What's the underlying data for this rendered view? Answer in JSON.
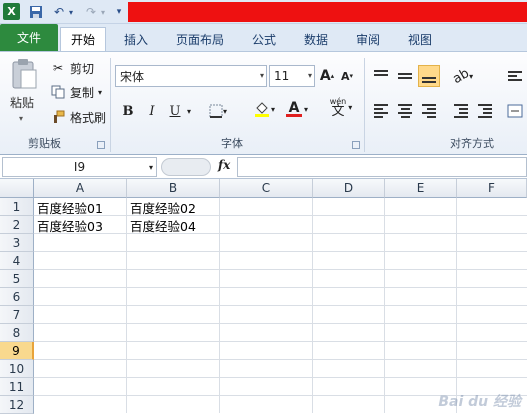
{
  "tabs": [
    "文件",
    "开始",
    "插入",
    "页面布局",
    "公式",
    "数据",
    "审阅",
    "视图"
  ],
  "clipboard": {
    "paste": "粘贴",
    "cut": "剪切",
    "copy": "复制",
    "format_painter": "格式刷",
    "group_label": "剪贴板"
  },
  "font": {
    "name": "宋体",
    "size": "11",
    "bold": "B",
    "italic": "I",
    "underline": "U",
    "group_label": "字体",
    "grow": "A",
    "shrink": "A",
    "color_letter": "A",
    "phonetic_top": "wén",
    "phonetic_char": "文",
    "font_color": "#e02020",
    "fill_color": "#ffff00"
  },
  "alignment": {
    "group_label": "对齐方式"
  },
  "formula_bar": {
    "cell_ref": "I9",
    "fx": "fx",
    "formula": ""
  },
  "columns": [
    "A",
    "B",
    "C",
    "D",
    "E",
    "F"
  ],
  "rows": [
    "1",
    "2",
    "3",
    "4",
    "5",
    "6",
    "7",
    "8",
    "9",
    "10",
    "11",
    "12"
  ],
  "active_row": "9",
  "cells": {
    "A1": "百度经验01",
    "B1": "百度经验02",
    "A2": "百度经验03",
    "B2": "百度经验04"
  },
  "watermark": "Bai du 经验"
}
